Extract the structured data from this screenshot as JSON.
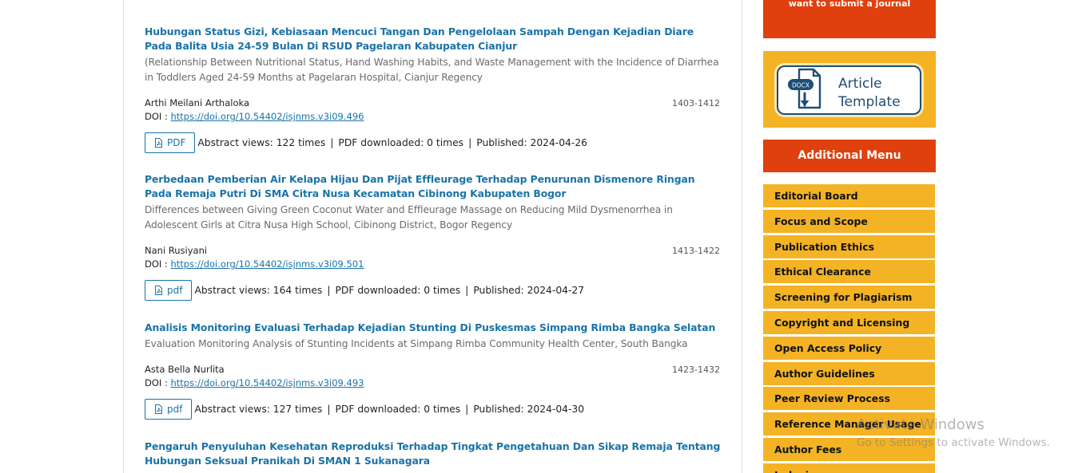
{
  "articles": [
    {
      "title": "Hubungan Status Gizi, Kebiasaan Mencuci Tangan Dan Pengelolaan Sampah Dengan Kejadian Diare Pada Balita Usia 24-59 Bulan Di RSUD Pagelaran Kabupaten Cianjur",
      "subtitle": "(Relationship Between Nutritional Status, Hand Washing Habits, and Waste Management with the Incidence of Diarrhea in Toddlers Aged 24-59 Months at Pagelaran Hospital, Cianjur Regency",
      "author": "Arthi Meilani Arthaloka",
      "pages": "1403-1412",
      "doi_label": "DOI :",
      "doi": "https://doi.org/10.54402/isjnms.v3i09.496",
      "galley": "PDF",
      "abstract_views": "Abstract views: 122 times",
      "pdf_downloads": "PDF downloaded: 0 times",
      "published": "Published: 2024-04-26"
    },
    {
      "title": "Perbedaan Pemberian Air Kelapa Hijau Dan Pijat Effleurage Terhadap Penurunan Dismenore Ringan Pada Remaja Putri Di SMA Citra Nusa Kecamatan Cibinong Kabupaten Bogor",
      "subtitle": "Differences between Giving Green Coconut Water and Effleurage Massage on Reducing Mild Dysmenorrhea in Adolescent Girls at Citra Nusa High School, Cibinong District, Bogor Regency",
      "author": "Nani Rusiyani",
      "pages": "1413-1422",
      "doi_label": "DOI :",
      "doi": "https://doi.org/10.54402/isjnms.v3i09.501",
      "galley": "pdf",
      "abstract_views": "Abstract views: 164 times",
      "pdf_downloads": "PDF downloaded: 0 times",
      "published": "Published: 2024-04-27"
    },
    {
      "title": "Analisis Monitoring Evaluasi Terhadap Kejadian Stunting Di Puskesmas Simpang Rimba Bangka Selatan",
      "subtitle": "Evaluation Monitoring Analysis of Stunting Incidents at Simpang Rimba Community Health Center, South Bangka",
      "author": "Asta Bella Nurlita",
      "pages": "1423-1432",
      "doi_label": "DOI :",
      "doi": "https://doi.org/10.54402/isjnms.v3i09.493",
      "galley": "pdf",
      "abstract_views": "Abstract views: 127 times",
      "pdf_downloads": "PDF downloaded: 0 times",
      "published": "Published: 2024-04-30"
    },
    {
      "title": "Pengaruh Penyuluhan Kesehatan Reproduksi Terhadap Tingkat Pengetahuan Dan Sikap Remaja Tentang Hubungan Seksual Pranikah Di SMAN 1 Sukanagara"
    }
  ],
  "stat_separator": "|",
  "sidebar": {
    "submit_banner": "want to submit a journal",
    "template_badge": "DOCX",
    "template_line1": "Article",
    "template_line2": "Template",
    "menu_title": "Additional Menu",
    "menu_items": [
      "Editorial Board",
      "Focus and Scope",
      "Publication Ethics",
      "Ethical Clearance",
      "Screening for Plagiarism",
      "Copyright and Licensing",
      "Open Access Policy",
      "Author Guidelines",
      "Peer Review Process",
      "Reference Manager Usage",
      "Author Fees",
      "Indexing"
    ]
  },
  "watermark": {
    "line1": "Activate Windows",
    "line2": "Go to Settings to activate Windows."
  },
  "colors": {
    "link": "#1a73a8",
    "accent_red": "#e0400e",
    "menu_yellow": "#f4b324"
  }
}
